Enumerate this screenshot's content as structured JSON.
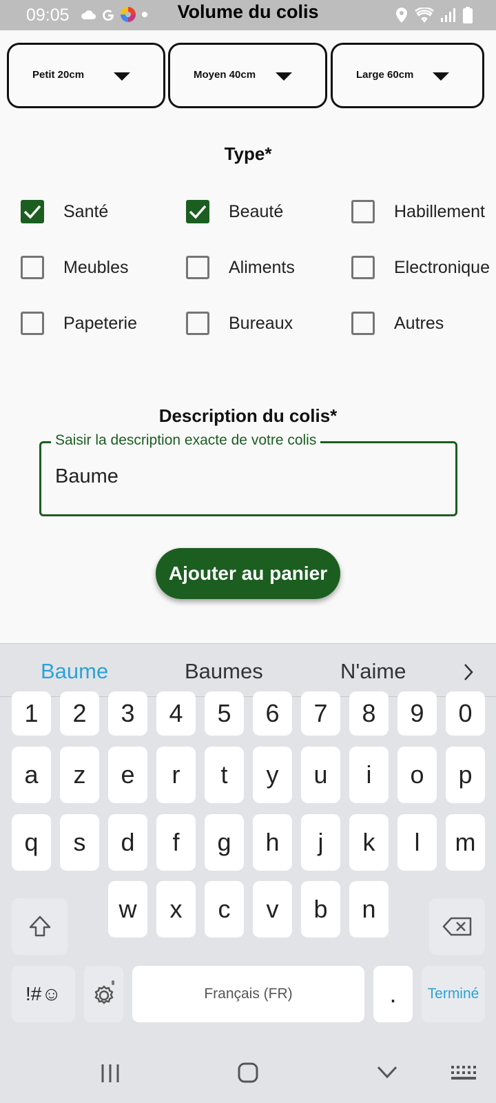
{
  "status_bar": {
    "time": "09:05",
    "title": "Volume du colis",
    "left_icons": [
      "cloud-icon",
      "google-icon",
      "color-app-icon",
      "dot-icon"
    ],
    "right_icons": [
      "location-icon",
      "wifi-icon",
      "signal-icon",
      "battery-icon"
    ]
  },
  "dropdowns": [
    {
      "label": "Petit 20cm"
    },
    {
      "label": "Moyen 40cm"
    },
    {
      "label": "Large 60cm"
    }
  ],
  "type_section": {
    "title": "Type*",
    "options": [
      {
        "label": "Santé",
        "checked": true
      },
      {
        "label": "Beauté",
        "checked": true
      },
      {
        "label": "Habillement",
        "checked": false
      },
      {
        "label": "Meubles",
        "checked": false
      },
      {
        "label": "Aliments",
        "checked": false
      },
      {
        "label": "Electronique",
        "checked": false
      },
      {
        "label": "Papeterie",
        "checked": false
      },
      {
        "label": "Bureaux",
        "checked": false
      },
      {
        "label": "Autres",
        "checked": false
      }
    ]
  },
  "description": {
    "title": "Description du colis*",
    "field_label": "Saisir la description exacte de votre colis",
    "value": "Baume"
  },
  "add_button": {
    "label": "Ajouter au panier"
  },
  "keyboard": {
    "suggestions": [
      "Baume",
      "Baumes",
      "N'aime"
    ],
    "number_row": [
      "1",
      "2",
      "3",
      "4",
      "5",
      "6",
      "7",
      "8",
      "9",
      "0"
    ],
    "row1": [
      "a",
      "z",
      "e",
      "r",
      "t",
      "y",
      "u",
      "i",
      "o",
      "p"
    ],
    "row2": [
      "q",
      "s",
      "d",
      "f",
      "g",
      "h",
      "j",
      "k",
      "l",
      "m"
    ],
    "row3": [
      "w",
      "x",
      "c",
      "v",
      "b",
      "n"
    ],
    "symbols_label": "!#☺",
    "space_label": "Français (FR)",
    "period_label": ".",
    "done_label": "Terminé"
  },
  "colors": {
    "accent_green": "#1b5e20",
    "suggestion_blue": "#2aa3d8",
    "status_bar_bg": "#bdbdbd",
    "keyboard_bg": "#e2e3e7"
  }
}
